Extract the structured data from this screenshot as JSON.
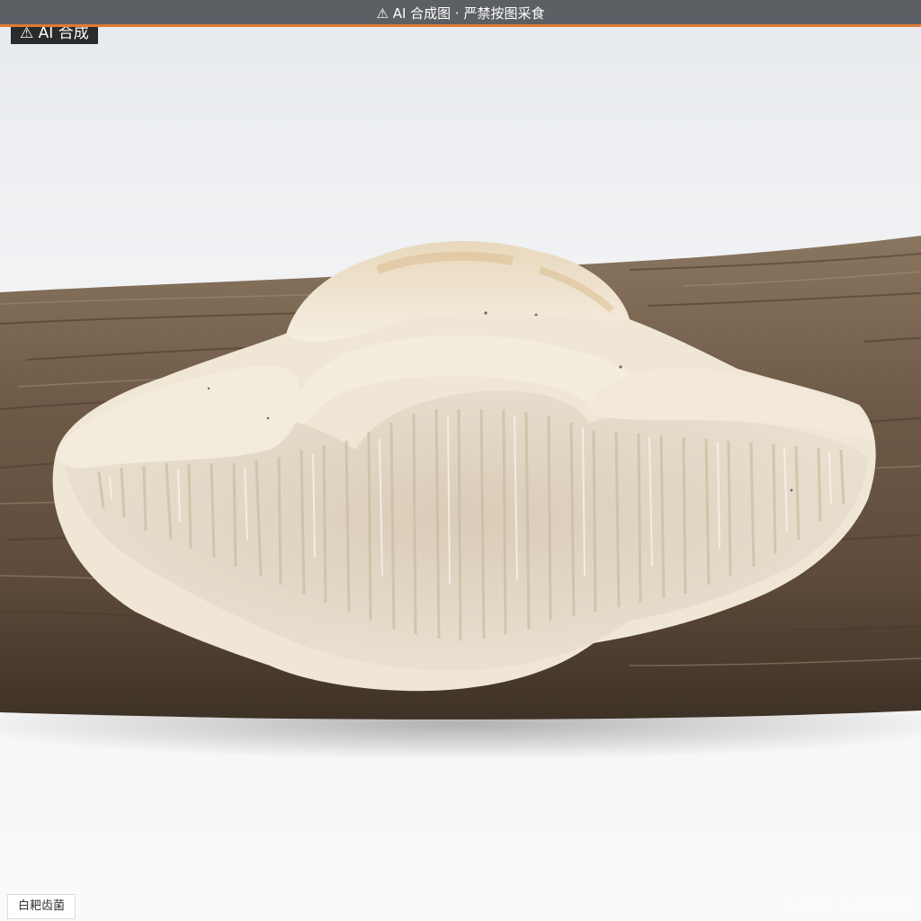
{
  "banner": {
    "text": "⚠ AI 合成图 · 严禁按图采食"
  },
  "badge": {
    "text": "⚠ AI 合成"
  },
  "caption": {
    "species": "白耙齿菌"
  },
  "watermark": {
    "text": "© 云菌志 · AI 合成示意图"
  },
  "colors": {
    "banner_bg": "#5c5f63",
    "banner_accent": "#e07a35",
    "background": "#f2f3f5",
    "log": "#6b5744",
    "fungus": "#efe6d6"
  }
}
